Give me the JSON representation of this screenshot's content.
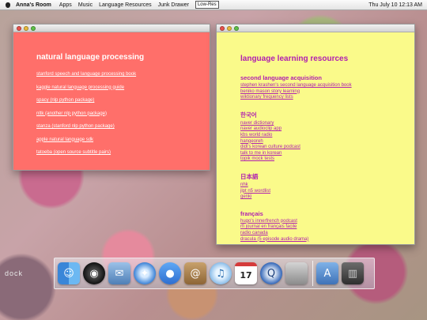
{
  "menubar": {
    "app_name": "Anna's Room",
    "items": [
      "Apps",
      "Music",
      "Language Resources",
      "Junk Drawer"
    ],
    "lowres_label": "Low-Res",
    "clock": "Thu July 10  12:13 AM"
  },
  "left_window": {
    "title": "natural language processing",
    "links": [
      "stanford speech and language processing book",
      "kaggle natural language processing guide",
      "spacy (nlp python package)",
      "nltk (another nlp python package)",
      "stanza (stanford nlp python package)",
      "apple natural language sdk",
      "tatoeba (open source subtitle pairs)"
    ]
  },
  "right_window": {
    "title": "language learning resources",
    "sections": [
      {
        "heading": "second language acquisition",
        "links": [
          "stephen krashen's second language acquisition book",
          "beniko mason story learning",
          "wiktionary frequency lists"
        ]
      },
      {
        "heading": "한국어",
        "links": [
          "naver dictionary",
          "naver audioclip app",
          "kbs world radio",
          "hangeoreh",
          "didi's korean culture podcast",
          "talk to me in korean",
          "topik mock tests"
        ]
      },
      {
        "heading": "日本語",
        "links": [
          "nhk",
          "jlpt n5 wordlist",
          "genki"
        ]
      },
      {
        "heading": "français",
        "links": [
          "hugo's innerfrench podcast",
          "rfi journal en français facile",
          "radio canada",
          "dracula (5 episode audio drama)"
        ]
      }
    ]
  },
  "dock": {
    "label": "dock",
    "icons": [
      {
        "name": "finder-icon",
        "glyph": "☺"
      },
      {
        "name": "dashboard-icon",
        "glyph": "◉"
      },
      {
        "name": "mail-icon",
        "glyph": "✉"
      },
      {
        "name": "safari-icon",
        "glyph": "✦"
      },
      {
        "name": "ichat-icon",
        "glyph": "●"
      },
      {
        "name": "address-book-icon",
        "glyph": "@"
      },
      {
        "name": "itunes-icon",
        "glyph": "♫"
      },
      {
        "name": "ical-icon",
        "glyph": "17"
      },
      {
        "name": "quicktime-icon",
        "glyph": "Q"
      },
      {
        "name": "system-preferences-icon",
        "glyph": ""
      },
      {
        "name": "applications-folder-icon",
        "glyph": "A"
      },
      {
        "name": "trash-icon",
        "glyph": "▥"
      }
    ]
  }
}
